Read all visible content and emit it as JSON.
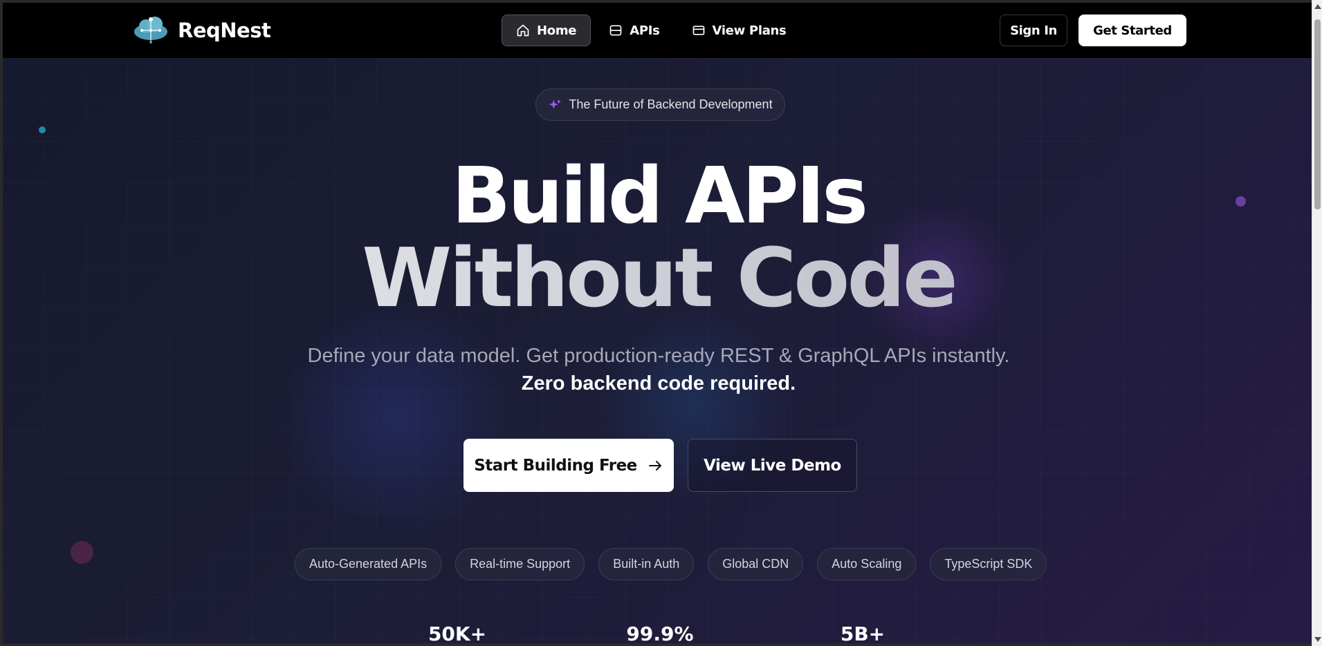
{
  "header": {
    "brand": "ReqNest",
    "nav": [
      {
        "label": "Home",
        "icon": "home-icon",
        "active": true
      },
      {
        "label": "APIs",
        "icon": "database-icon",
        "active": false
      },
      {
        "label": "View Plans",
        "icon": "credit-card-icon",
        "active": false
      }
    ],
    "sign_in": "Sign In",
    "get_started": "Get Started"
  },
  "hero": {
    "badge": "The Future of Backend Development",
    "title_line1": "Build APIs",
    "title_line2": "Without Code",
    "subtitle_regular": "Define your data model. Get production-ready REST & GraphQL APIs instantly.",
    "subtitle_strong": "Zero backend code required.",
    "cta_primary": "Start Building Free",
    "cta_secondary": "View Live Demo",
    "features": [
      "Auto-Generated APIs",
      "Real-time Support",
      "Built-in Auth",
      "Global CDN",
      "Auto Scaling",
      "TypeScript SDK"
    ],
    "stats": [
      "50K+",
      "99.9%",
      "5B+"
    ]
  },
  "colors": {
    "accent_purple": "#a855f7",
    "background": "#1a1930",
    "header": "#000000"
  }
}
